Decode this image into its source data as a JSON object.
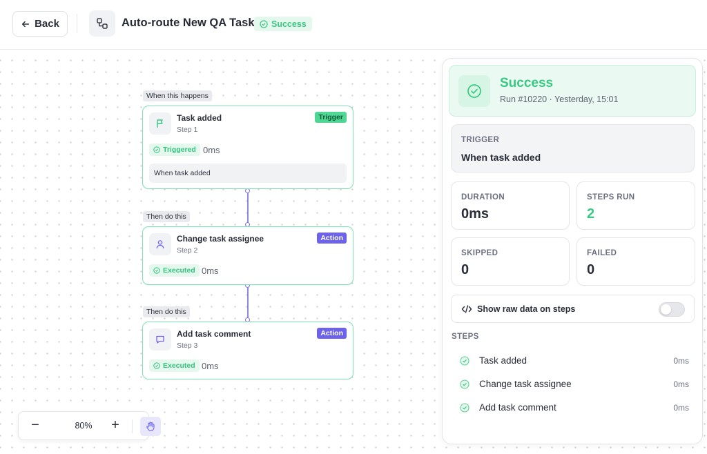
{
  "header": {
    "back_label": "Back",
    "title": "Auto-route New QA Tasks",
    "status": "Success"
  },
  "canvas": {
    "nodes": [
      {
        "section_label": "When this happens",
        "title": "Task added",
        "step": "Step 1",
        "badge": "Trigger",
        "status": "Triggered",
        "duration": "0ms",
        "detail": "When task added",
        "icon": "flag-icon"
      },
      {
        "section_label": "Then do this",
        "title": "Change task assignee",
        "step": "Step 2",
        "badge": "Action",
        "status": "Executed",
        "duration": "0ms",
        "icon": "user-icon"
      },
      {
        "section_label": "Then do this",
        "title": "Add task comment",
        "step": "Step 3",
        "badge": "Action",
        "status": "Executed",
        "duration": "0ms",
        "icon": "comment-icon"
      }
    ],
    "zoom": {
      "minus": "−",
      "level": "80%",
      "plus": "+"
    }
  },
  "panel": {
    "status_title": "Success",
    "run_info": "Run #10220 · Yesterday, 15:01",
    "trigger": {
      "label": "TRIGGER",
      "value": "When task added"
    },
    "stats": {
      "duration": {
        "label": "DURATION",
        "value": "0ms"
      },
      "steps_run": {
        "label": "STEPS RUN",
        "value": "2"
      },
      "skipped": {
        "label": "SKIPPED",
        "value": "0"
      },
      "failed": {
        "label": "FAILED",
        "value": "0"
      }
    },
    "raw_toggle": {
      "label": "Show raw data on steps",
      "on": false
    },
    "steps_heading": "STEPS",
    "steps": [
      {
        "name": "Task added",
        "duration": "0ms"
      },
      {
        "name": "Change task assignee",
        "duration": "0ms"
      },
      {
        "name": "Add task comment",
        "duration": "0ms"
      }
    ]
  },
  "colors": {
    "success": "#38c983",
    "accent": "#6c63ea",
    "node_border": "#7ee3b4"
  }
}
